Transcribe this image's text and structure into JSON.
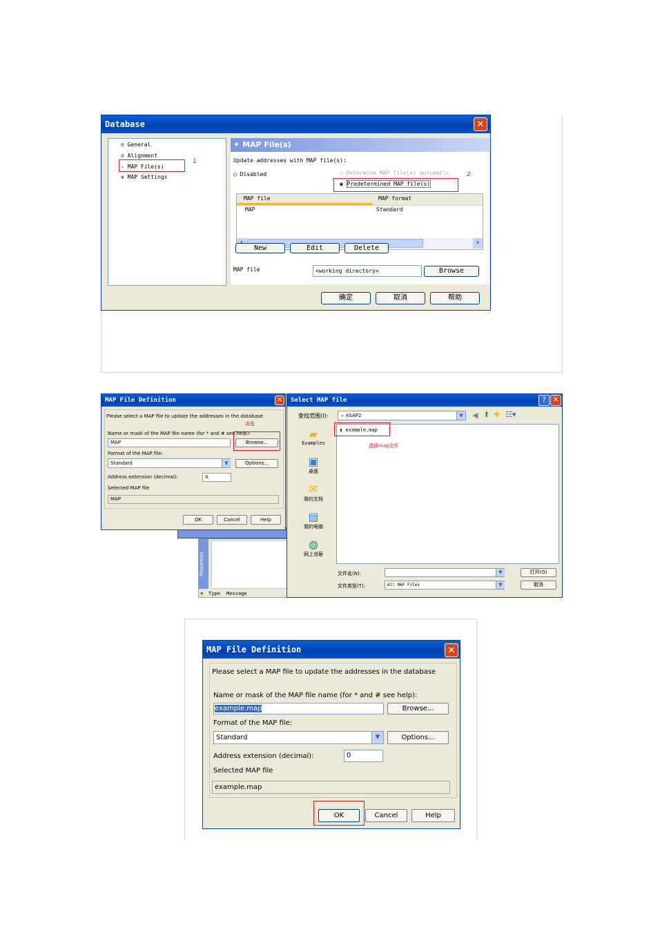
{
  "dlg1": {
    "title": "Database",
    "tree": [
      "General",
      "Alignment",
      "MAP File(s)",
      "MAP Settings"
    ],
    "annot1": "1",
    "annot2": "2",
    "header": "MAP File(s)",
    "update_label": "Update addresses with MAP file(s):",
    "opt_disabled": "Disabled",
    "opt_determine": "Determine MAP file(s) automatic",
    "opt_predetermined": "Predetermined MAP file(s)",
    "col_mapfile": "MAP file",
    "col_format": "MAP format",
    "row_mapfile": "MAP",
    "row_format": "Standard",
    "btn_new": "New",
    "btn_edit": "Edit",
    "btn_delete": "Delete",
    "mapfile_label": "MAP file",
    "mapfile_value": "<working directory>",
    "btn_browse": "Browse",
    "btn_ok": "确定",
    "btn_cancel": "取消",
    "btn_help": "帮助"
  },
  "dlg2": {
    "title": "MAP File Definition",
    "prompt": "Please select a MAP file to update the addresses in the database",
    "annot_click": "点击",
    "name_label": "Name or mask of the MAP file name (for * and # see help):",
    "name_value": "MAP",
    "browse": "Browse...",
    "format_label": "Format of the MAP file:",
    "format_value": "Standard",
    "options": "Options...",
    "ext_label": "Address extension (decimal):",
    "ext_value": "0",
    "selected_label": "Selected MAP file",
    "selected_value": "MAP",
    "ok": "OK",
    "cancel": "Cancel",
    "help": "Help",
    "props_tab": "Properties",
    "col_type": "Type",
    "col_message": "Message"
  },
  "dlg3": {
    "title": "Select MAP file",
    "lookin_label": "查找范围(I):",
    "lookin_value": "ASAP2",
    "places": [
      "Examples",
      "桌面",
      "我的文档",
      "我的电脑",
      "网上邻居"
    ],
    "file": "example.map",
    "annot_select": "选择map文件",
    "filename_label": "文件名(N):",
    "filetype_label": "文件类型(T):",
    "filetype_value": "All MAP Files",
    "open": "打开(O)",
    "cancel": "取消"
  },
  "dlg4": {
    "title": "MAP File Definition",
    "prompt": "Please select a MAP file to update the addresses in the database",
    "name_label": "Name or mask of the MAP file name (for * and # see help):",
    "name_value": "example.map",
    "browse": "Browse...",
    "format_label": "Format of the MAP file:",
    "format_value": "Standard",
    "options": "Options...",
    "ext_label": "Address extension (decimal):",
    "ext_value": "0",
    "selected_label": "Selected MAP file",
    "selected_value": "example.map",
    "ok": "OK",
    "cancel": "Cancel",
    "help": "Help"
  },
  "colors": {
    "accent": "#0a52c8",
    "annotation": "#e3161d",
    "dialog_bg": "#ece9d8"
  }
}
